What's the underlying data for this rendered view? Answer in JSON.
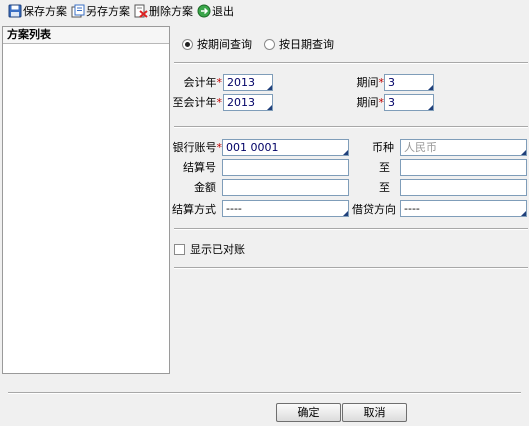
{
  "toolbar": {
    "save_label": "保存方案",
    "save_as_label": "另存方案",
    "delete_label": "删除方案",
    "exit_label": "退出"
  },
  "sidebar": {
    "title": "方案列表"
  },
  "query_mode": {
    "by_period": "按期间查询",
    "by_date": "按日期查询",
    "selected": "by_period"
  },
  "period": {
    "from_year_label": "会计年",
    "from_year": "2013",
    "from_period_label": "期间",
    "from_period": "3",
    "to_year_label": "至会计年",
    "to_year": "2013",
    "to_period_label": "期间",
    "to_period": "3"
  },
  "filters": {
    "account_label": "银行账号",
    "account": "001 0001",
    "currency_label": "币种",
    "currency": "人民币",
    "settle_no_label": "结算号",
    "settle_no_from": "",
    "to_label": "至",
    "settle_no_to": "",
    "amount_label": "金额",
    "amount_from": "",
    "amount_to": "",
    "settle_method_label": "结算方式",
    "settle_method": "----",
    "direction_label": "借贷方向",
    "direction": "----"
  },
  "show_reconciled": {
    "label": "显示已对账",
    "checked": false
  },
  "buttons": {
    "ok": "确定",
    "cancel": "取消"
  },
  "colors": {
    "required": "#c00000",
    "field_border": "#7f9db9",
    "corner_marker": "#1f3f7a"
  }
}
